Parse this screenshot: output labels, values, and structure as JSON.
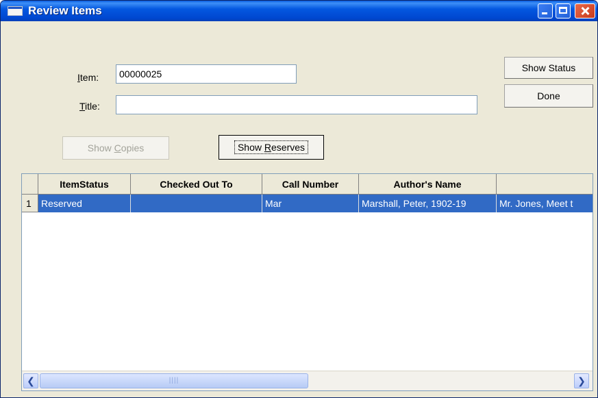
{
  "window": {
    "title": "Review Items"
  },
  "form": {
    "item_label_pre": "",
    "item_label_u": "I",
    "item_label_post": "tem:",
    "item_value": "00000025",
    "title_label_u": "T",
    "title_label_post": "itle:",
    "title_value": ""
  },
  "buttons": {
    "show_status": "Show Status",
    "done": "Done",
    "show_copies_pre": "Show ",
    "show_copies_u": "C",
    "show_copies_post": "opies",
    "show_reserves_pre": "Show ",
    "show_reserves_u": "R",
    "show_reserves_post": "eserves"
  },
  "grid": {
    "columns": [
      "ItemStatus",
      "Checked Out To",
      "Call Number",
      "Author's Name",
      ""
    ],
    "rows": [
      {
        "num": "1",
        "cells": [
          "Reserved",
          "",
          "Mar",
          "Marshall, Peter, 1902-19",
          "Mr. Jones, Meet t"
        ],
        "selected": true
      }
    ]
  },
  "scrollbar": {
    "thumb_grip": "||||"
  },
  "colors": {
    "selection": "#316ac5",
    "titlebar": "#0054e3",
    "window_bg": "#ece9d8"
  }
}
